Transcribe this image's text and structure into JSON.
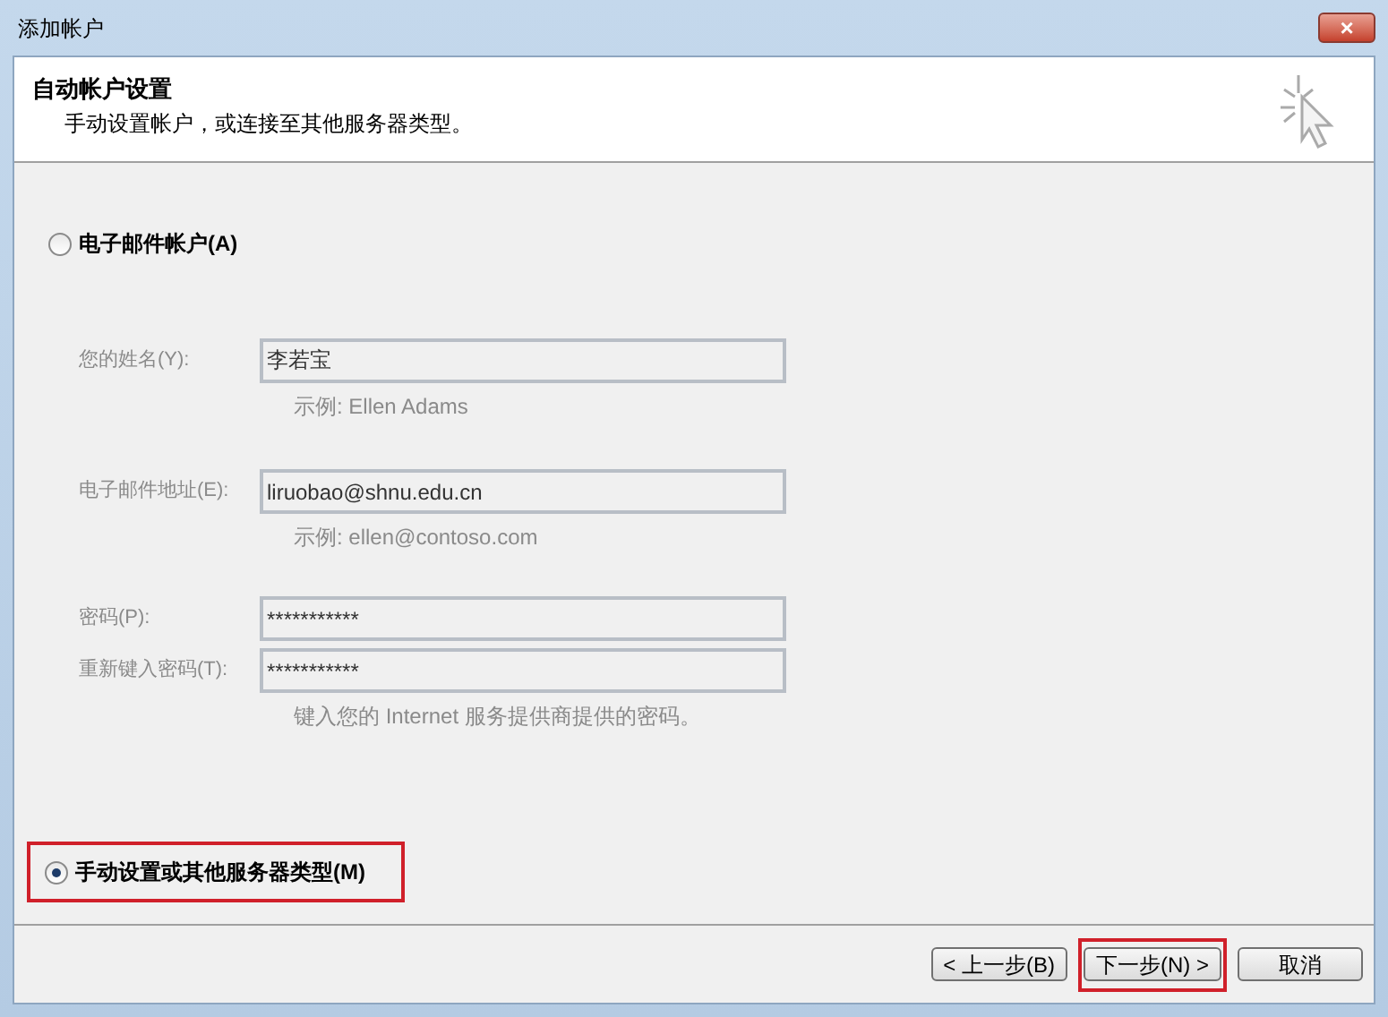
{
  "window": {
    "title": "添加帐户",
    "close": "×"
  },
  "header": {
    "title": "自动帐户设置",
    "subtitle": "手动设置帐户，或连接至其他服务器类型。"
  },
  "options": [
    {
      "kind": "email",
      "label": "电子邮件帐户(A)",
      "selected": false,
      "highlighted": false
    },
    {
      "kind": "manual",
      "label": "手动设置或其他服务器类型(M)",
      "selected": true,
      "highlighted": true
    }
  ],
  "fields": [
    {
      "label": "您的姓名(Y):",
      "value": "李若宝",
      "hint": "示例: Ellen Adams",
      "disabled": true
    },
    {
      "label": "电子邮件地址(E):",
      "value": "liruobao@shnu.edu.cn",
      "hint": "示例: ellen@contoso.com",
      "disabled": true
    },
    {
      "label": "密码(P):",
      "value": "***********",
      "disabled": true
    },
    {
      "label": "重新键入密码(T):",
      "value": "***********",
      "hint": "键入您的 Internet 服务提供商提供的密码。",
      "disabled": true
    }
  ],
  "buttons": [
    {
      "label": "< 上一步(B)",
      "highlighted": false
    },
    {
      "label": "下一步(N) >",
      "highlighted": true
    },
    {
      "label": "取消",
      "highlighted": false
    }
  ]
}
